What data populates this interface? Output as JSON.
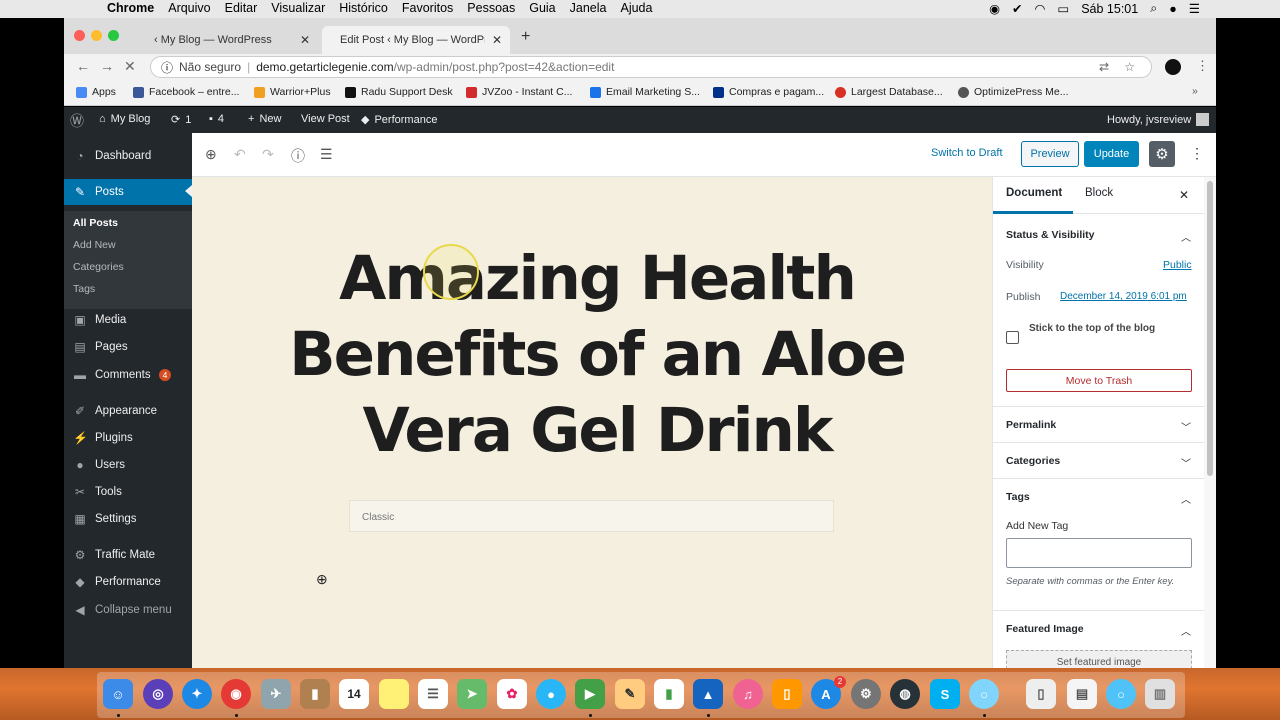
{
  "mac_menubar": {
    "app": "Chrome",
    "menus": [
      "Arquivo",
      "Editar",
      "Visualizar",
      "Histórico",
      "Favoritos",
      "Pessoas",
      "Guia",
      "Janela",
      "Ajuda"
    ],
    "clock": "Sáb 15:01"
  },
  "browser": {
    "tabs": [
      {
        "title": "‹ My Blog — WordPress",
        "active": false
      },
      {
        "title": "Edit Post ‹ My Blog — WordPre",
        "active": true
      }
    ],
    "omnibox": {
      "security": "Não seguro",
      "host": "demo.getarticlegenie.com",
      "path": "/wp-admin/post.php?post=42&action=edit"
    },
    "bookmarks": [
      {
        "label": "Apps",
        "color": "#4a8af4"
      },
      {
        "label": "Facebook – entre...",
        "color": "#3b5998"
      },
      {
        "label": "Warrior+Plus",
        "color": "#f0a020"
      },
      {
        "label": "Radu Support Desk",
        "color": "#111111"
      },
      {
        "label": "JVZoo - Instant C...",
        "color": "#d22b2b"
      },
      {
        "label": "Email Marketing S...",
        "color": "#1a73e8"
      },
      {
        "label": "Compras e pagam...",
        "color": "#003087"
      },
      {
        "label": "Largest Database...",
        "color": "#d93025"
      },
      {
        "label": "OptimizePress Me...",
        "color": "#555555"
      }
    ]
  },
  "adminbar": {
    "site": "My Blog",
    "updates": "1",
    "comments": "4",
    "new": "New",
    "view_post": "View Post",
    "performance": "Performance",
    "howdy": "Howdy, jvsreview"
  },
  "sidebar": {
    "dashboard": "Dashboard",
    "posts": "Posts",
    "posts_sub": [
      "All Posts",
      "Add New",
      "Categories",
      "Tags"
    ],
    "media": "Media",
    "pages": "Pages",
    "comments": "Comments",
    "comments_badge": "4",
    "appearance": "Appearance",
    "plugins": "Plugins",
    "users": "Users",
    "tools": "Tools",
    "settings": "Settings",
    "traffic_mate": "Traffic Mate",
    "performance": "Performance",
    "collapse": "Collapse menu"
  },
  "editor": {
    "switch_to_draft": "Switch to Draft",
    "preview": "Preview",
    "update": "Update",
    "post_title": "Amazing Health Benefits of an Aloe Vera Gel Drink",
    "classic_block": "Classic"
  },
  "panel": {
    "tab_document": "Document",
    "tab_block": "Block",
    "status_visibility": "Status & Visibility",
    "visibility_label": "Visibility",
    "visibility_value": "Public",
    "publish_label": "Publish",
    "publish_value": "December 14, 2019 6:01 pm",
    "sticky_label": "Stick to the top of the blog",
    "move_to_trash": "Move to Trash",
    "permalink": "Permalink",
    "categories": "Categories",
    "tags": "Tags",
    "add_new_tag": "Add New Tag",
    "tag_hint": "Separate with commas or the Enter key.",
    "featured_image": "Featured Image",
    "set_featured_image": "Set featured image"
  },
  "dock": {
    "calendar_day": "14",
    "appstore_badge": "2"
  },
  "colors": {
    "wp_admin_dark": "#23282d",
    "wp_blue": "#0073aa",
    "update_button": "#0085ba",
    "canvas_bg": "#f5efe0",
    "trash_red": "#b32d2e"
  }
}
